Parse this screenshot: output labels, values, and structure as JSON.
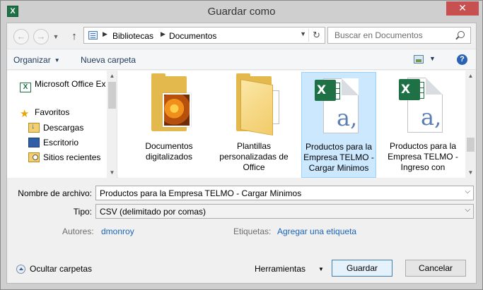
{
  "window": {
    "title": "Guardar como",
    "app_icon": "excel-app-icon",
    "close_label": "✕"
  },
  "nav": {
    "back": "←",
    "forward": "→",
    "up": "↑",
    "breadcrumb": [
      "Bibliotecas",
      "Documentos"
    ],
    "search_placeholder": "Buscar en Documentos"
  },
  "toolbar": {
    "organize": "Organizar",
    "new_folder": "Nueva carpeta"
  },
  "sidebar": {
    "items": [
      {
        "label": "Microsoft Office Ex",
        "icon": "excel-icon"
      },
      {
        "label": "Favoritos",
        "icon": "star-icon"
      },
      {
        "label": "Descargas",
        "icon": "downloads-icon"
      },
      {
        "label": "Escritorio",
        "icon": "desktop-icon"
      },
      {
        "label": "Sitios recientes",
        "icon": "recent-places-icon"
      }
    ]
  },
  "files": [
    {
      "label": "Documentos digitalizados",
      "type": "folder",
      "icon": "folder-photo-icon",
      "selected": false
    },
    {
      "label": "Plantillas personalizadas de Office",
      "type": "folder",
      "icon": "folder-icon",
      "selected": false
    },
    {
      "label": "Productos para la Empresa TELMO - Cargar Minimos",
      "type": "csv",
      "icon": "excel-csv-icon",
      "selected": true
    },
    {
      "label": "Productos para la Empresa TELMO - Ingreso con",
      "type": "csv",
      "icon": "excel-csv-icon",
      "selected": false
    }
  ],
  "form": {
    "filename_label": "Nombre de archivo:",
    "filename_value": "Productos para la Empresa TELMO - Cargar Minimos",
    "type_label": "Tipo:",
    "type_value": "CSV (delimitado por comas)",
    "authors_label": "Autores:",
    "authors_value": "dmonroy",
    "tags_label": "Etiquetas:",
    "tags_value": "Agregar una etiqueta"
  },
  "footer": {
    "hide_folders": "Ocultar carpetas",
    "tools": "Herramientas",
    "save": "Guardar",
    "cancel": "Cancelar"
  },
  "colors": {
    "selection": "#cce8ff",
    "close_button": "#c75050",
    "link": "#1a64b4"
  }
}
